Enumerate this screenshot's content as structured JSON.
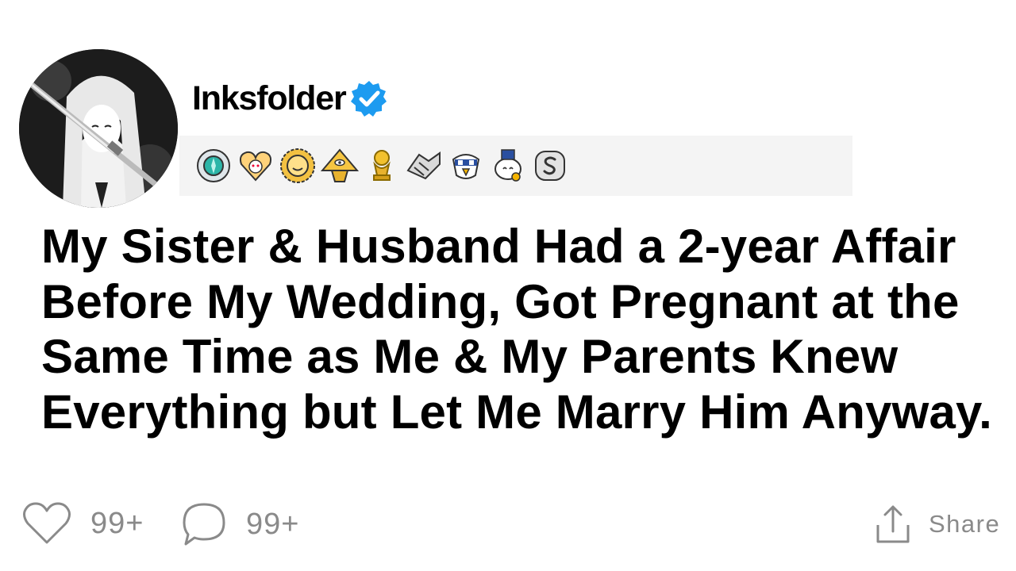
{
  "post": {
    "author": {
      "username": "Inksfolder",
      "verified": true,
      "avatar": "anime-swordswoman-avatar",
      "verified_icon": "verified-check-icon",
      "badge_color": "#1d9bf0"
    },
    "badges": [
      {
        "name": "gem-award-icon"
      },
      {
        "name": "heart-snoo-award-icon"
      },
      {
        "name": "sun-award-icon"
      },
      {
        "name": "illuminati-pyramid-award-icon"
      },
      {
        "name": "gold-trophy-award-icon"
      },
      {
        "name": "handshake-award-icon"
      },
      {
        "name": "eagle-award-icon"
      },
      {
        "name": "wholesome-snoo-award-icon"
      },
      {
        "name": "silver-s-award-icon"
      }
    ],
    "title": "My Sister & Husband Had a 2-year Affair Before My Wedding, Got Pregnant at the Same Time as Me & My Parents Knew Everything but Let Me Marry Him Anyway.",
    "actions": {
      "likes": "99+",
      "comments": "99+",
      "share_label": "Share"
    }
  }
}
